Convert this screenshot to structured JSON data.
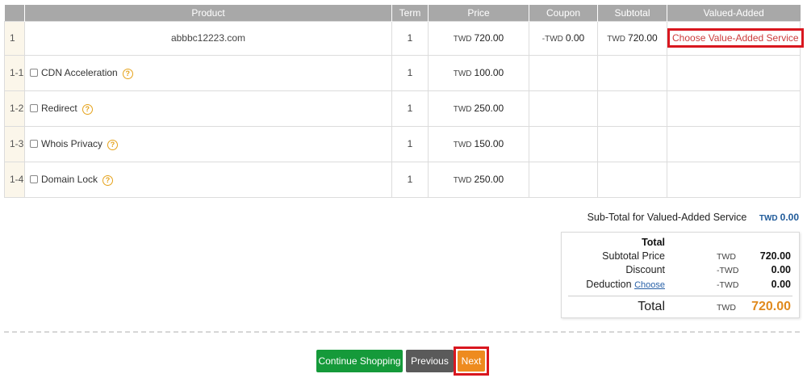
{
  "table": {
    "headers": [
      "",
      "Product",
      "Term",
      "Price",
      "Coupon",
      "Subtotal",
      "Valued-Added"
    ],
    "main_row": {
      "index": "1",
      "product": "abbbc12223.com",
      "term": "1",
      "price_currency": "TWD",
      "price": "720.00",
      "coupon_currency": "-TWD",
      "coupon": "0.00",
      "subtotal_currency": "TWD",
      "subtotal": "720.00",
      "value_added_button": "Choose Value-Added Service"
    },
    "addons": [
      {
        "index": "1-1",
        "name": "CDN Acceleration",
        "term": "1",
        "currency": "TWD",
        "price": "100.00"
      },
      {
        "index": "1-2",
        "name": "Redirect",
        "term": "1",
        "currency": "TWD",
        "price": "250.00"
      },
      {
        "index": "1-3",
        "name": "Whois Privacy",
        "term": "1",
        "currency": "TWD",
        "price": "150.00"
      },
      {
        "index": "1-4",
        "name": "Domain Lock",
        "term": "1",
        "currency": "TWD",
        "price": "250.00"
      }
    ],
    "help_glyph": "?"
  },
  "value_added_subtotal": {
    "label": "Sub-Total for Valued-Added Service",
    "currency": "TWD",
    "amount": "0.00"
  },
  "totals": {
    "heading": "Total",
    "subtotal_label": "Subtotal Price",
    "subtotal_currency": "TWD",
    "subtotal_value": "720.00",
    "discount_label": "Discount",
    "discount_currency": "-TWD",
    "discount_value": "0.00",
    "deduction_label": "Deduction",
    "deduction_link": "Choose",
    "deduction_currency": "-TWD",
    "deduction_value": "0.00",
    "total_label": "Total",
    "total_currency": "TWD",
    "total_value": "720.00"
  },
  "buttons": {
    "continue": "Continue Shopping",
    "previous": "Previous",
    "next": "Next"
  },
  "colors": {
    "accent_orange": "#ee8b1f",
    "highlight_red": "#d9171f",
    "continue_green": "#159a3a",
    "previous_gray": "#5a5a5a",
    "link_blue": "#2a62a8"
  }
}
